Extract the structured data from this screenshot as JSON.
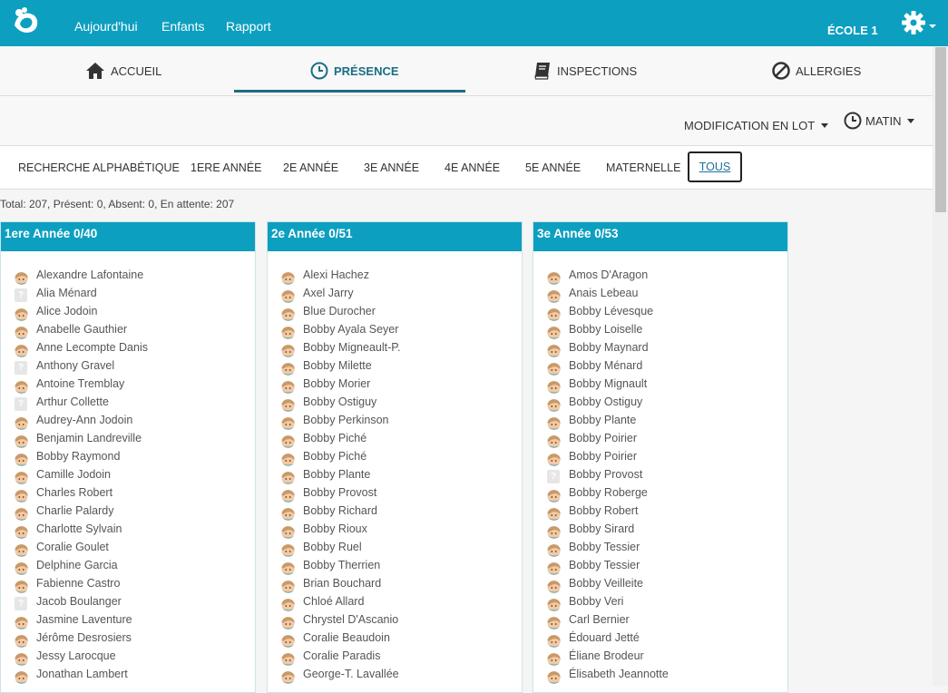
{
  "navbar": {
    "links": [
      "Aujourd'hui",
      "Enfants",
      "Rapport"
    ],
    "school": "ÉCOLE 1"
  },
  "main_tabs": {
    "accueil": "ACCUEIL",
    "presence": "PRÉSENCE",
    "inspections": "INSPECTIONS",
    "allergies": "ALLERGIES",
    "active": "presence"
  },
  "toolbar": {
    "batch_edit": "MODIFICATION EN LOT",
    "period": "MATIN"
  },
  "grade_filters": {
    "alpha": "RECHERCHE ALPHABÉTIQUE",
    "g1": "1ERE ANNÉE",
    "g2": "2E ANNÉE",
    "g3": "3E ANNÉE",
    "g4": "4E ANNÉE",
    "g5": "5E ANNÉE",
    "k": "MATERNELLE",
    "all": "TOUS",
    "active": "all"
  },
  "summary": "Total: 207, Présent: 0, Absent: 0, En attente: 207",
  "colors": {
    "brand": "#0d9fc0",
    "active_tab": "#1a6e85"
  },
  "icons": {
    "logo": "logo-icon",
    "settings": "gear-icon",
    "home": "home-icon",
    "clock": "clock-icon",
    "book": "book-icon",
    "ban": "ban-icon",
    "avatar": "child-avatar-icon",
    "no_photo": "question-mark-icon"
  },
  "columns": [
    {
      "title": "1ere Année 0/40",
      "students": [
        {
          "name": "Alexandre Lafontaine",
          "photo": true
        },
        {
          "name": "Alia Ménard",
          "photo": false
        },
        {
          "name": "Alice Jodoin",
          "photo": true
        },
        {
          "name": "Anabelle Gauthier",
          "photo": true
        },
        {
          "name": "Anne Lecompte Danis",
          "photo": true
        },
        {
          "name": "Anthony Gravel",
          "photo": false
        },
        {
          "name": "Antoine Tremblay",
          "photo": true
        },
        {
          "name": "Arthur Collette",
          "photo": false
        },
        {
          "name": "Audrey-Ann Jodoin",
          "photo": true
        },
        {
          "name": "Benjamin Landreville",
          "photo": true
        },
        {
          "name": "Bobby Raymond",
          "photo": true
        },
        {
          "name": "Camille Jodoin",
          "photo": true
        },
        {
          "name": "Charles Robert",
          "photo": true
        },
        {
          "name": "Charlie Palardy",
          "photo": true
        },
        {
          "name": "Charlotte Sylvain",
          "photo": true
        },
        {
          "name": "Coralie Goulet",
          "photo": true
        },
        {
          "name": "Delphine Garcia",
          "photo": true
        },
        {
          "name": "Fabienne Castro",
          "photo": true
        },
        {
          "name": "Jacob Boulanger",
          "photo": false
        },
        {
          "name": "Jasmine Laventure",
          "photo": true
        },
        {
          "name": "Jérôme Desrosiers",
          "photo": true
        },
        {
          "name": "Jessy Larocque",
          "photo": true
        },
        {
          "name": "Jonathan Lambert",
          "photo": true
        }
      ]
    },
    {
      "title": "2e Année 0/51",
      "students": [
        {
          "name": "Alexi Hachez",
          "photo": true
        },
        {
          "name": "Axel Jarry",
          "photo": true
        },
        {
          "name": "Blue Durocher",
          "photo": true
        },
        {
          "name": "Bobby Ayala Seyer",
          "photo": true
        },
        {
          "name": "Bobby Migneault-P.",
          "photo": true
        },
        {
          "name": "Bobby Milette",
          "photo": true
        },
        {
          "name": "Bobby Morier",
          "photo": true
        },
        {
          "name": "Bobby Ostiguy",
          "photo": true
        },
        {
          "name": "Bobby Perkinson",
          "photo": true
        },
        {
          "name": "Bobby Piché",
          "photo": true
        },
        {
          "name": "Bobby Piché",
          "photo": true
        },
        {
          "name": "Bobby Plante",
          "photo": true
        },
        {
          "name": "Bobby Provost",
          "photo": true
        },
        {
          "name": "Bobby Richard",
          "photo": true
        },
        {
          "name": "Bobby Rioux",
          "photo": true
        },
        {
          "name": "Bobby Ruel",
          "photo": true
        },
        {
          "name": "Bobby Therrien",
          "photo": true
        },
        {
          "name": "Brian Bouchard",
          "photo": true
        },
        {
          "name": "Chloé Allard",
          "photo": true
        },
        {
          "name": "Chrystel D'Ascanio",
          "photo": true
        },
        {
          "name": "Coralie Beaudoin",
          "photo": true
        },
        {
          "name": "Coralie Paradis",
          "photo": true
        },
        {
          "name": "George-T. Lavallée",
          "photo": true
        }
      ]
    },
    {
      "title": "3e Année 0/53",
      "students": [
        {
          "name": "Amos D'Aragon",
          "photo": true
        },
        {
          "name": "Anais Lebeau",
          "photo": true
        },
        {
          "name": "Bobby Lévesque",
          "photo": true
        },
        {
          "name": "Bobby Loiselle",
          "photo": true
        },
        {
          "name": "Bobby Maynard",
          "photo": true
        },
        {
          "name": "Bobby Ménard",
          "photo": true
        },
        {
          "name": "Bobby Mignault",
          "photo": true
        },
        {
          "name": "Bobby Ostiguy",
          "photo": true
        },
        {
          "name": "Bobby Plante",
          "photo": true
        },
        {
          "name": "Bobby Poirier",
          "photo": true
        },
        {
          "name": "Bobby Poirier",
          "photo": true
        },
        {
          "name": "Bobby Provost",
          "photo": false
        },
        {
          "name": "Bobby Roberge",
          "photo": true
        },
        {
          "name": "Bobby Robert",
          "photo": true
        },
        {
          "name": "Bobby Sirard",
          "photo": true
        },
        {
          "name": "Bobby Tessier",
          "photo": true
        },
        {
          "name": "Bobby Tessier",
          "photo": true
        },
        {
          "name": "Bobby Veilleite",
          "photo": true
        },
        {
          "name": "Bobby Veri",
          "photo": true
        },
        {
          "name": "Carl Bernier",
          "photo": true
        },
        {
          "name": "Édouard Jetté",
          "photo": true
        },
        {
          "name": "Éliane Brodeur",
          "photo": true
        },
        {
          "name": "Élisabeth Jeannotte",
          "photo": true
        }
      ]
    }
  ]
}
